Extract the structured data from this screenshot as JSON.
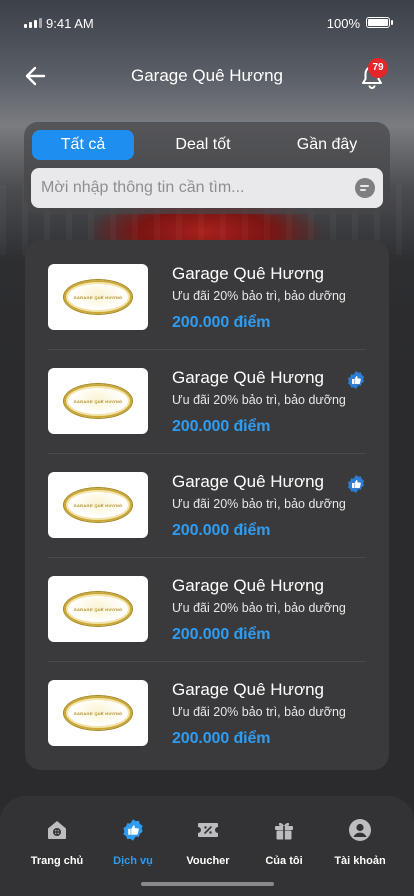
{
  "status_bar": {
    "time": "9:41 AM",
    "battery": "100%"
  },
  "header": {
    "title": "Garage Quê Hương",
    "notification_count": "79"
  },
  "tabs": [
    {
      "label": "Tất cả",
      "active": true
    },
    {
      "label": "Deal tốt",
      "active": false
    },
    {
      "label": "Gần đây",
      "active": false
    }
  ],
  "search": {
    "placeholder": "Mời nhập thông tin cần tìm..."
  },
  "items": [
    {
      "title": "Garage Quê Hương",
      "description": "Ưu đãi 20% bảo trì, bảo dưỡng",
      "points": "200.000 điểm",
      "liked": false,
      "logo_text": "GARAGE QUÊ HƯƠNG"
    },
    {
      "title": "Garage Quê Hương",
      "description": "Ưu đãi 20% bảo trì, bảo dưỡng",
      "points": "200.000 điểm",
      "liked": true,
      "logo_text": "GARAGE QUÊ HƯƠNG"
    },
    {
      "title": "Garage Quê Hương",
      "description": "Ưu đãi 20% bảo trì, bảo dưỡng",
      "points": "200.000 điểm",
      "liked": true,
      "logo_text": "GARAGE QUÊ HƯƠNG"
    },
    {
      "title": "Garage Quê Hương",
      "description": "Ưu đãi 20% bảo trì, bảo dưỡng",
      "points": "200.000 điểm",
      "liked": false,
      "logo_text": "GARAGE QUÊ HƯƠNG"
    },
    {
      "title": "Garage Quê Hương",
      "description": "Ưu đãi 20% bảo trì, bảo dưỡng",
      "points": "200.000 điểm",
      "liked": false,
      "logo_text": "GARAGE QUÊ HƯƠNG"
    }
  ],
  "bottom_nav": [
    {
      "label": "Trang chủ",
      "icon": "home-icon",
      "active": false
    },
    {
      "label": "Dịch vụ",
      "icon": "thumbs-up-icon",
      "active": true
    },
    {
      "label": "Voucher",
      "icon": "voucher-icon",
      "active": false
    },
    {
      "label": "Của tôi",
      "icon": "gift-icon",
      "active": false
    },
    {
      "label": "Tài khoản",
      "icon": "account-icon",
      "active": false
    }
  ],
  "colors": {
    "accent": "#2d9cf2",
    "tab_active": "#1f8ef1",
    "badge": "#e5252a",
    "panel": "#3a3a3c"
  }
}
